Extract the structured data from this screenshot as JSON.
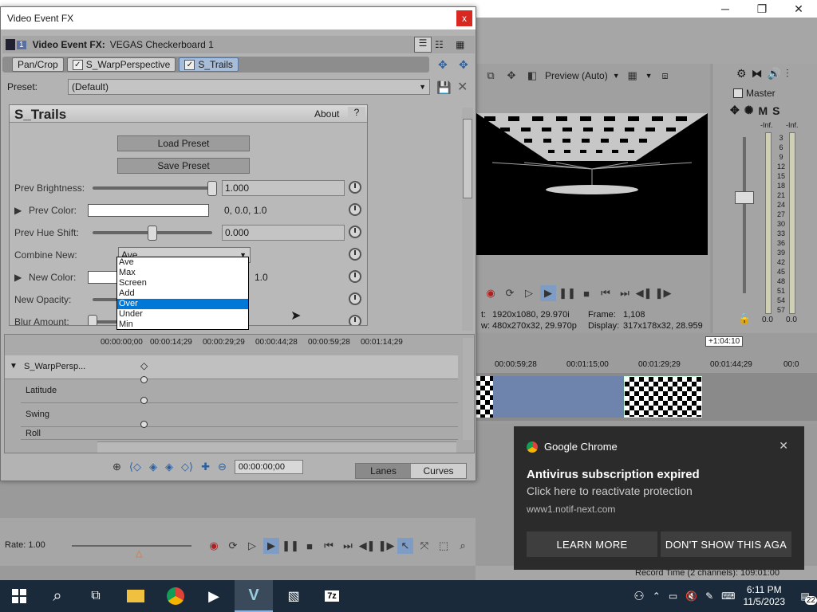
{
  "dialog": {
    "title": "Video Event FX",
    "close": "x",
    "track_num": "1",
    "header_label": "Video Event FX:",
    "header_media": "VEGAS Checkerboard 1",
    "chain": [
      "Pan/Crop",
      "S_WarpPerspective",
      "S_Trails"
    ],
    "preset_label": "Preset:",
    "preset_value": "(Default)"
  },
  "plugin": {
    "name": "S_Trails",
    "about": "About",
    "help": "?",
    "load_preset": "Load Preset",
    "save_preset": "Save Preset",
    "params": [
      {
        "label": "Prev Brightness:",
        "value": "1.000",
        "slider_level": 1.0
      },
      {
        "label": "Prev Color:",
        "value": "0, 0.0, 1.0",
        "color": "#ffffff"
      },
      {
        "label": "Prev Hue Shift:",
        "value": "0.000",
        "slider_level": 0.5
      },
      {
        "label": "Combine New:",
        "value": "Ave"
      },
      {
        "label": "New Color:",
        "value": "1.0",
        "color": "#ffffff"
      },
      {
        "label": "New Opacity:",
        "value": ""
      },
      {
        "label": "Blur Amount:",
        "value": ""
      }
    ],
    "combine_options": [
      "Ave",
      "Max",
      "Screen",
      "Add",
      "Over",
      "Under",
      "Min"
    ],
    "combine_highlighted": "Over"
  },
  "keyframes": {
    "ruler": [
      "00:00:00;00",
      "00:00:14;29",
      "00:00:29;29",
      "00:00:44;28",
      "00:00:59;28",
      "00:01:14;29"
    ],
    "tracks": [
      "S_WarpPersp...",
      "Latitude",
      "Swing",
      "Roll"
    ],
    "time": "00:00:00;00",
    "tab_lanes": "Lanes",
    "tab_curves": "Curves"
  },
  "preview": {
    "mode": "Preview (Auto)",
    "info_1_label": "t:",
    "info_1_value": "1920x1080, 29.970i",
    "info_1b_label": "Frame:",
    "info_1b_value": "1,108",
    "info_2_label": "w:",
    "info_2_value": "480x270x32, 29.970p",
    "info_2b_label": "Display:",
    "info_2b_value": "317x178x32, 28.959"
  },
  "master": {
    "label": "Master",
    "mute": "M",
    "solo": "S",
    "inf_left": "-Inf.",
    "inf_right": "-Inf.",
    "scale": [
      "3",
      "6",
      "9",
      "12",
      "15",
      "18",
      "21",
      "24",
      "27",
      "30",
      "33",
      "36",
      "39",
      "42",
      "45",
      "48",
      "51",
      "54",
      "57"
    ],
    "val_left": "0.0",
    "val_right": "0.0"
  },
  "timeline": {
    "ruler": [
      "00:00:59;28",
      "00:01:15;00",
      "00:01:29;29",
      "00:01:44;29",
      "00:0"
    ],
    "marker": "+1:04:10"
  },
  "bottom": {
    "rate": "Rate: 1.00",
    "record_time": "Record Time (2 channels): 109:01:00"
  },
  "notification": {
    "app": "Google Chrome",
    "title": "Antivirus subscription expired",
    "body": "Click here to reactivate protection",
    "source": "www1.notif-next.com",
    "btn_learn": "LEARN MORE",
    "btn_dont": "DON'T SHOW THIS AGA"
  },
  "taskbar": {
    "time": "6:11 PM",
    "date": "11/5/2023",
    "badge": "22"
  },
  "colors": {
    "accent": "#0078d7",
    "chip_selected": "#a7bcd6",
    "notif_bg": "#2b2b2b",
    "taskbar_bg": "#1a2a3a"
  }
}
